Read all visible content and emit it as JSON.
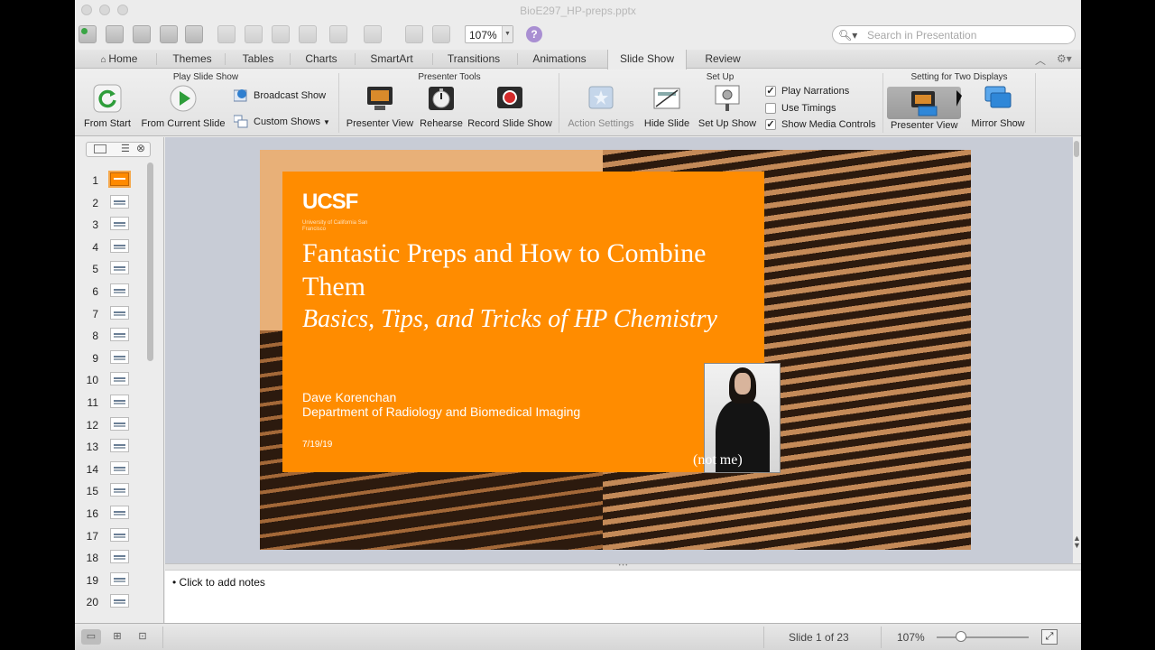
{
  "window": {
    "title": "BioE297_HP-preps.pptx"
  },
  "toolbar": {
    "zoom": "107%",
    "help": "?",
    "search_placeholder": "Search in Presentation"
  },
  "tabs": [
    {
      "label": "Home",
      "icon": "home-icon"
    },
    {
      "label": "Themes"
    },
    {
      "label": "Tables"
    },
    {
      "label": "Charts"
    },
    {
      "label": "SmartArt"
    },
    {
      "label": "Transitions"
    },
    {
      "label": "Animations"
    },
    {
      "label": "Slide Show",
      "active": true
    },
    {
      "label": "Review"
    }
  ],
  "ribbon": {
    "groups": {
      "play": "Play Slide Show",
      "presenter": "Presenter Tools",
      "setup": "Set Up",
      "two_displays": "Setting for Two Displays"
    },
    "buttons": {
      "from_start": "From Start",
      "from_current": "From Current Slide",
      "broadcast": "Broadcast Show",
      "custom": "Custom Shows",
      "presenter_view": "Presenter View",
      "rehearse": "Rehearse",
      "record": "Record Slide Show",
      "action_settings": "Action Settings",
      "hide_slide": "Hide Slide",
      "setup_show": "Set Up Show",
      "presenter_view_2": "Presenter View",
      "mirror_show": "Mirror Show"
    },
    "checks": {
      "play_narrations": {
        "label": "Play Narrations",
        "checked": true
      },
      "use_timings": {
        "label": "Use Timings",
        "checked": false
      },
      "media_controls": {
        "label": "Show Media Controls",
        "checked": true
      }
    }
  },
  "thumbnails": [
    "1",
    "2",
    "3",
    "4",
    "5",
    "6",
    "7",
    "8",
    "9",
    "10",
    "11",
    "12",
    "13",
    "14",
    "15",
    "16",
    "17",
    "18",
    "19",
    "20"
  ],
  "slide": {
    "logo": "UCSF",
    "logo_sub": "University of California San Francisco",
    "title": "Fantastic Preps and How to Combine Them",
    "subtitle": "Basics, Tips, and Tricks of  HP Chemistry",
    "author": "Dave Korenchan",
    "department": "Department of Radiology and Biomedical Imaging",
    "date": "7/19/19",
    "caption": "(not me)"
  },
  "notes": {
    "placeholder": "Click to add notes"
  },
  "status": {
    "slide_count": "Slide 1 of 23",
    "zoom": "107%",
    "zoom_level_percent": 107
  },
  "colors": {
    "slide_orange": "#ff8c00",
    "accent_selected_thumb": "#ff8a00"
  }
}
